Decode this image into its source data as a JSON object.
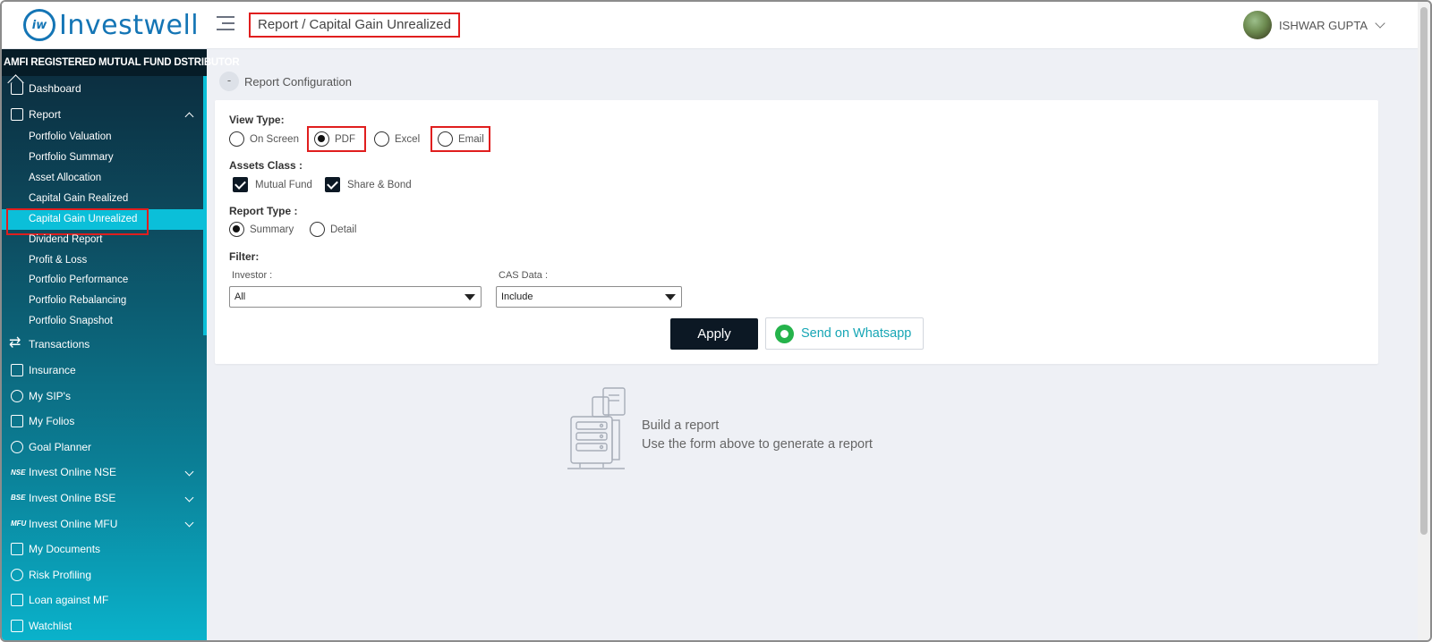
{
  "app": {
    "logo_mark": "iw",
    "logo_text": "Investwell"
  },
  "header": {
    "breadcrumb": "Report / Capital Gain Unrealized",
    "user_name": "ISHWAR GUPTA"
  },
  "sidebar": {
    "distributor_label": "AMFI REGISTERED MUTUAL FUND DSTRIBUTOR",
    "items": [
      {
        "label": "Dashboard",
        "icon": "home-icon"
      },
      {
        "label": "Report",
        "icon": "report-icon",
        "expanded": true
      },
      {
        "label": "Transactions",
        "icon": "transfer-icon"
      },
      {
        "label": "Insurance",
        "icon": "insurance-icon"
      },
      {
        "label": "My SIP's",
        "icon": "sip-icon"
      },
      {
        "label": "My Folios",
        "icon": "folio-icon"
      },
      {
        "label": "Goal Planner",
        "icon": "goal-icon"
      },
      {
        "label": "Invest Online NSE",
        "badge": "NSE"
      },
      {
        "label": "Invest Online BSE",
        "badge": "BSE"
      },
      {
        "label": "Invest Online MFU",
        "badge": "MFU"
      },
      {
        "label": "My Documents",
        "icon": "document-icon"
      },
      {
        "label": "Risk Profiling",
        "icon": "gauge-icon"
      },
      {
        "label": "Loan against MF",
        "icon": "loan-icon"
      },
      {
        "label": "Watchlist",
        "icon": "watchlist-icon"
      }
    ],
    "report_sub_items": [
      "Portfolio Valuation",
      "Portfolio Summary",
      "Asset Allocation",
      "Capital Gain Realized",
      "Capital Gain Unrealized",
      "Dividend Report",
      "Profit & Loss",
      "Portfolio Performance",
      "Portfolio Rebalancing",
      "Portfolio Snapshot"
    ],
    "active_sub_item": "Capital Gain Unrealized"
  },
  "config": {
    "toggle": "-",
    "title": "Report Configuration",
    "view_type": {
      "label": "View Type:",
      "options": [
        "On Screen",
        "PDF",
        "Excel",
        "Email"
      ],
      "selected": "PDF"
    },
    "assets_class": {
      "label": "Assets Class :",
      "options": [
        "Mutual Fund",
        "Share & Bond"
      ],
      "checked": [
        "Mutual Fund",
        "Share & Bond"
      ]
    },
    "report_type": {
      "label": "Report Type :",
      "options": [
        "Summary",
        "Detail"
      ],
      "selected": "Summary"
    },
    "filter": {
      "label": "Filter:",
      "investor_label": "Investor :",
      "investor_value": "All",
      "cas_label": "CAS Data :",
      "cas_value": "Include"
    },
    "apply_label": "Apply",
    "whatsapp_label": "Send on Whatsapp"
  },
  "empty_state": {
    "title": "Build a report",
    "subtitle": "Use the form above to generate a report"
  },
  "colors": {
    "brand": "#1475b5",
    "sidebar_active": "#0bbfd9",
    "highlight_border": "#e01e1e",
    "primary_button": "#0c1824",
    "whatsapp_green": "#25b34b"
  }
}
